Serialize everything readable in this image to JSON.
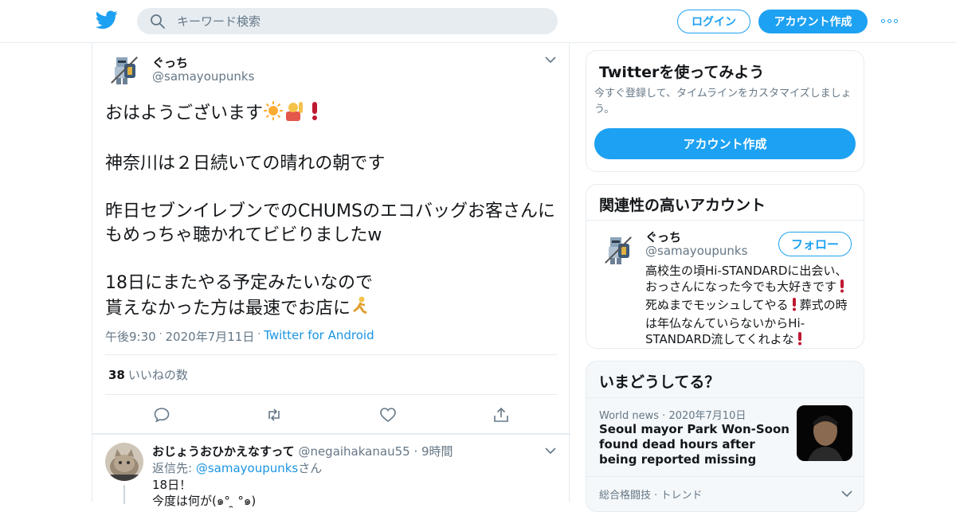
{
  "header": {
    "search_placeholder": "キーワード検索",
    "login_label": "ログイン",
    "signup_label": "アカウント作成"
  },
  "tweet": {
    "author_name": "ぐっち",
    "author_handle": "@samayoupunks",
    "lines": [
      "おはようございます",
      "神奈川は２日続いての晴れの朝です",
      "昨日セブンイレブンでのCHUMSのエコバッグお客さんにもめっちゃ聴かれてビビりましたw",
      "18日にまたやる予定みたいなので",
      "貰えなかった方は最速でお店に"
    ],
    "time": "午後9:30",
    "date": "2020年7月11日",
    "source": "Twitter for Android",
    "like_count": "38",
    "like_label": "いいねの数"
  },
  "reply": {
    "author_name": "おじょうおひかえなすって",
    "author_handle": "@negaihakanau55",
    "time_ago": "9時間",
    "reply_prefix": "返信先:",
    "reply_target": "@samayoupunks",
    "reply_suffix": "さん",
    "line1": "18日！",
    "line2": "今度は何が(๑°  ̯ °๑)"
  },
  "signup_card": {
    "title": "Twitterを使ってみよう",
    "description": "今すぐ登録して、タイムラインをカスタマイズしましょう。",
    "button": "アカウント作成"
  },
  "related_card": {
    "title": "関連性の高いアカウント",
    "name": "ぐっち",
    "handle": "@samayoupunks",
    "follow_label": "フォロー",
    "bio_parts": [
      "高校生の頃Hi-STANDARDに出会い、おっさんになった今でも大好きです",
      " 死ぬまでモッシュしてやる",
      "葬式の時は年仏なんていらないからHi-STANDARD流してくれよな"
    ]
  },
  "trends_card": {
    "title": "いまどうしてる？",
    "news_category": "World news",
    "news_date": "2020年7月10日",
    "news_title": "Seoul mayor Park Won-Soon found dead hours after being reported missing",
    "trend_category": "総合格闘技",
    "trend_type": "トレンド"
  },
  "colors": {
    "accent": "#1da1f2",
    "link": "#1b95e0",
    "muted": "#657786",
    "border": "#e6ecf0"
  }
}
